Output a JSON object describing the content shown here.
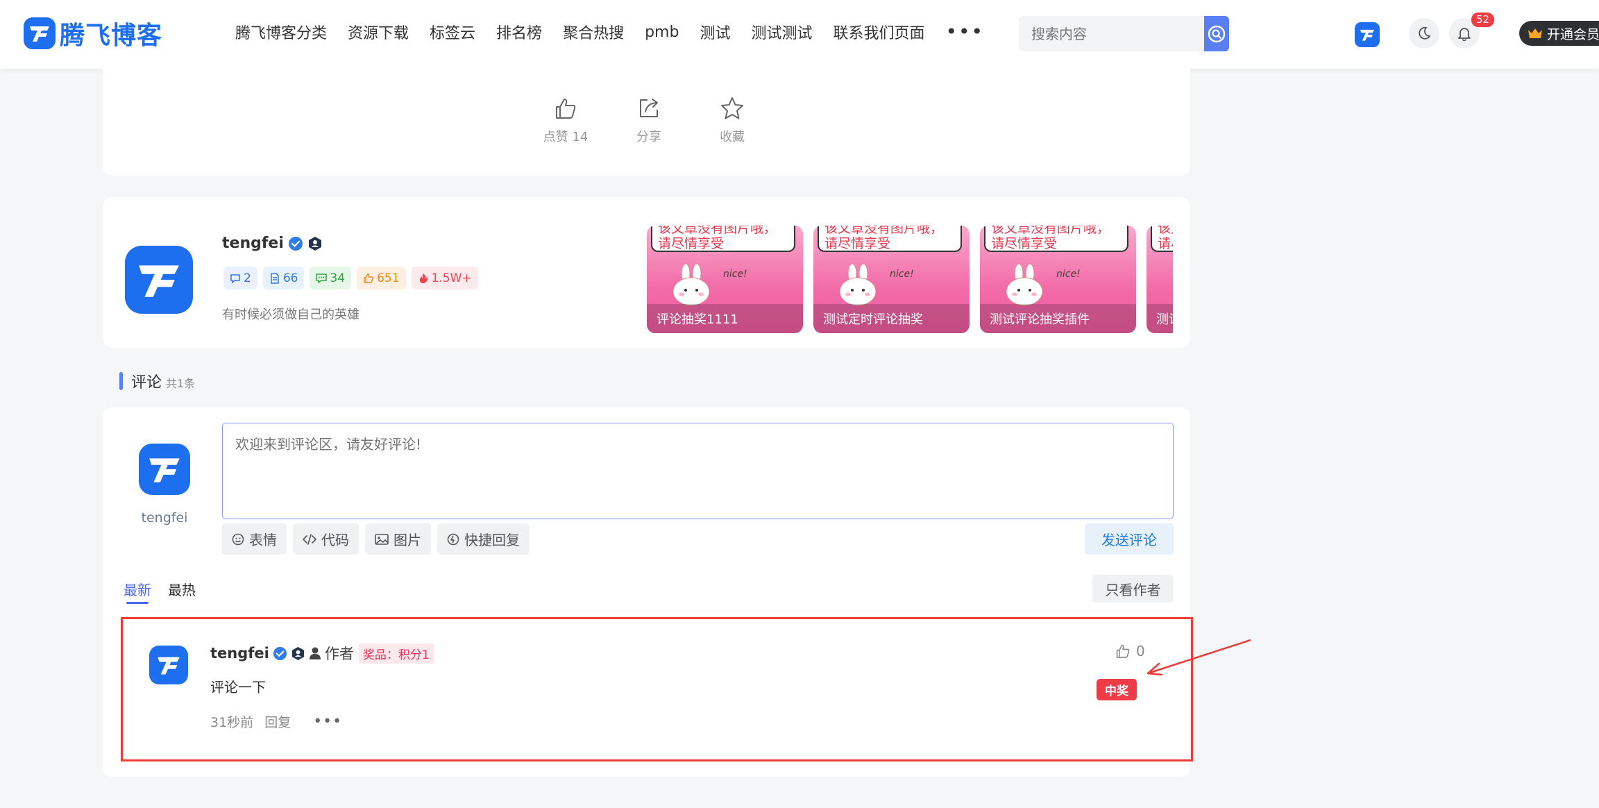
{
  "header": {
    "logo_text": "腾飞博客",
    "nav": [
      "腾飞博客分类",
      "资源下载",
      "标签云",
      "排名榜",
      "聚合热搜",
      "pmb",
      "测试",
      "测试测试",
      "联系我们页面"
    ],
    "more_label": "•••",
    "search_placeholder": "搜索内容",
    "notification_count": "52",
    "vip_label": "开通会员"
  },
  "post_actions": {
    "like_label": "点赞 14",
    "share_label": "分享",
    "collect_label": "收藏"
  },
  "author_card": {
    "name": "tengfei",
    "stats": [
      {
        "icon": "comment-icon",
        "value": "2",
        "color": "#3b6cf0",
        "bg": "#eaf0fe"
      },
      {
        "icon": "article-icon",
        "value": "66",
        "color": "#2f7be0",
        "bg": "#e8f2fd"
      },
      {
        "icon": "chat-icon",
        "value": "34",
        "color": "#2ca43a",
        "bg": "#e6f6e8"
      },
      {
        "icon": "like-icon",
        "value": "651",
        "color": "#f08a16",
        "bg": "#fdf0e2"
      },
      {
        "icon": "fire-icon",
        "value": "1.5W+",
        "color": "#f0434f",
        "bg": "#fdeaec"
      }
    ],
    "signature": "有时候必须做自己的英雄",
    "posts": [
      {
        "caption": "评论抽奖1111",
        "bubble": "该文章没有图片哦，请尽情享受"
      },
      {
        "caption": "测试定时评论抽奖",
        "bubble": "该文章没有图片哦，请尽情享受"
      },
      {
        "caption": "测试评论抽奖插件",
        "bubble": "该文章没有图片哦，请尽情享受"
      },
      {
        "caption": "测试",
        "bubble": "该文章没有图片哦，请尽情享受"
      }
    ]
  },
  "comments_section": {
    "title": "评论",
    "count": "共1条",
    "current_user": "tengfei",
    "input_placeholder": "欢迎来到评论区，请友好评论!",
    "tools": [
      {
        "icon": "smile-icon",
        "label": "表情"
      },
      {
        "icon": "code-icon",
        "label": "代码"
      },
      {
        "icon": "image-icon",
        "label": "图片"
      },
      {
        "icon": "quick-reply-icon",
        "label": "快捷回复"
      }
    ],
    "send_label": "发送评论",
    "tab_new": "最新",
    "tab_hot": "最热",
    "only_author_label": "只看作者"
  },
  "comment": {
    "name": "tengfei",
    "role": "作者",
    "prize": "奖品：积分1",
    "text": "评论一下",
    "time": "31秒前",
    "reply_label": "回复",
    "more_label": "•••",
    "likes": "0",
    "win_label": "中奖"
  },
  "colors": {
    "brand": "#1e6ff0",
    "accent": "#5a7ff5",
    "highlight_border": "#ee3b3b",
    "win_badge": "#ef3b47"
  }
}
